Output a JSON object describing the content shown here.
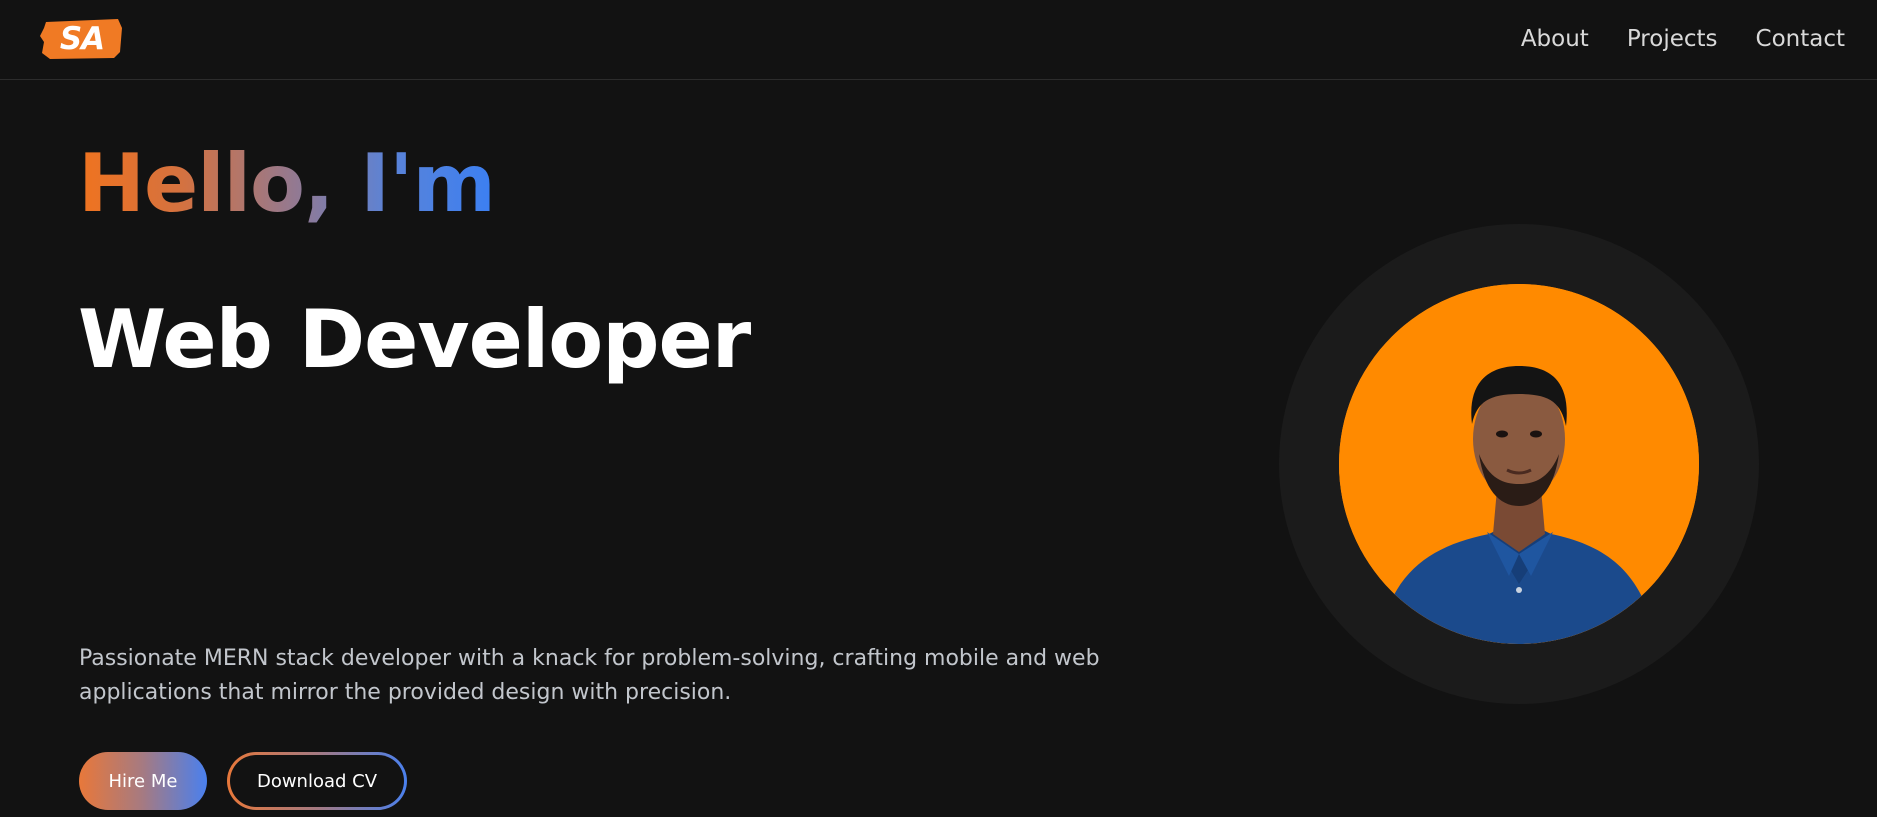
{
  "header": {
    "logo_text": "SA",
    "logo_color": "#f07a24",
    "nav": [
      {
        "label": "About"
      },
      {
        "label": "Projects"
      },
      {
        "label": "Contact"
      }
    ]
  },
  "hero": {
    "greeting": "Hello, I'm",
    "role": "Web Developer",
    "description": "Passionate MERN stack developer with a knack for problem-solving, crafting mobile and web applications that mirror the provided design with precision.",
    "buttons": {
      "hire": "Hire Me",
      "download": "Download CV"
    }
  },
  "profile": {
    "avatar_bg": "#ff8a00",
    "ring_color": "#1b1b1b"
  },
  "colors": {
    "background": "#121212",
    "accent_orange": "#f0731f",
    "accent_blue": "#3b7ff2"
  }
}
